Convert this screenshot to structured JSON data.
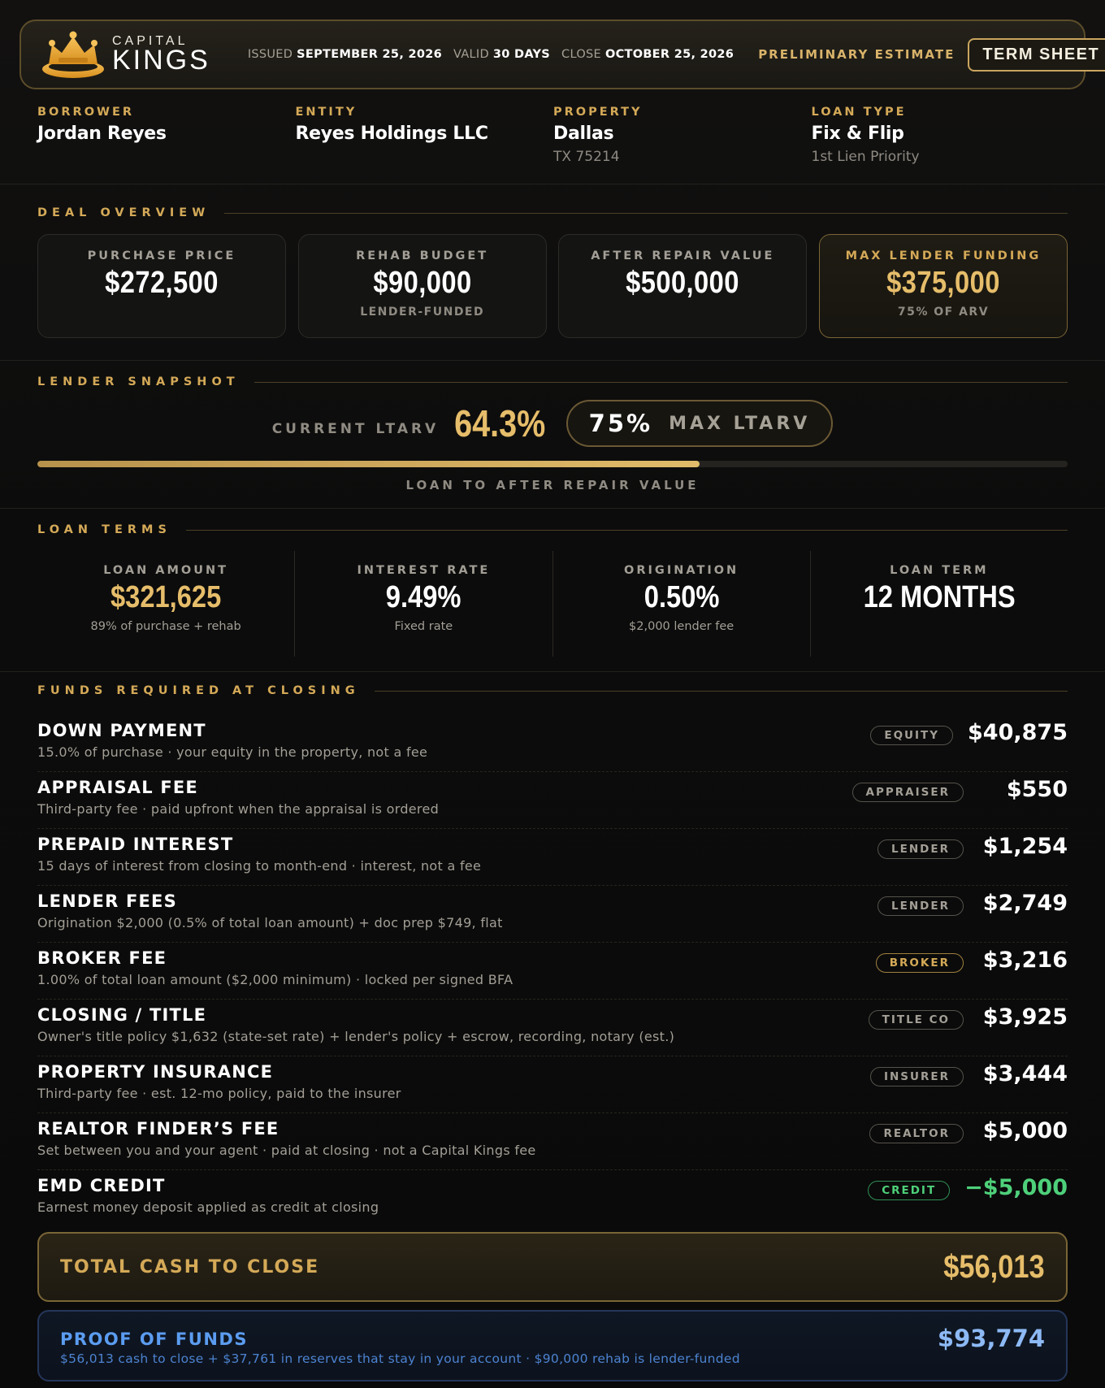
{
  "header": {
    "brand_line1": "CAPITAL",
    "brand_line2": "KINGS",
    "issued_label": "ISSUED",
    "issued_value": "SEPTEMBER 25, 2026",
    "valid_label": "VALID",
    "valid_value": "30 DAYS",
    "close_label": "CLOSE",
    "close_value": "OCTOBER 25, 2026",
    "status": "PRELIMINARY ESTIMATE",
    "button_label": "TERM SHEET",
    "colors": {
      "accent": "#d4a957",
      "border": "#5c4d2a"
    }
  },
  "info": [
    {
      "label": "BORROWER",
      "value": "Jordan Reyes",
      "sub": ""
    },
    {
      "label": "ENTITY",
      "value": "Reyes Holdings LLC",
      "sub": ""
    },
    {
      "label": "PROPERTY",
      "value": "Dallas",
      "sub": "TX 75214"
    },
    {
      "label": "LOAN TYPE",
      "value": "Fix & Flip",
      "sub": "1st Lien Priority"
    }
  ],
  "deal_overview": {
    "title": "DEAL OVERVIEW",
    "cards": [
      {
        "label": "PURCHASE PRICE",
        "value": "$272,500",
        "sub": ""
      },
      {
        "label": "REHAB BUDGET",
        "value": "$90,000",
        "sub": "LENDER-FUNDED"
      },
      {
        "label": "AFTER REPAIR VALUE",
        "value": "$500,000",
        "sub": ""
      },
      {
        "label": "MAX LENDER FUNDING",
        "value": "$375,000",
        "sub": "75% OF ARV"
      }
    ]
  },
  "snapshot": {
    "title": "LENDER SNAPSHOT",
    "current_label": "CURRENT LTARV",
    "current_value": "64.3%",
    "max_value": "75%",
    "max_label": "MAX LTARV",
    "progress_fraction": 0.643,
    "bar_label": "LOAN TO AFTER REPAIR VALUE"
  },
  "loan_terms": {
    "title": "LOAN TERMS",
    "items": [
      {
        "label": "LOAN AMOUNT",
        "value": "$321,625",
        "sub": "89% of purchase + rehab"
      },
      {
        "label": "INTEREST RATE",
        "value": "9.49%",
        "sub": "Fixed rate"
      },
      {
        "label": "ORIGINATION",
        "value": "0.50%",
        "sub": "$2,000 lender fee"
      },
      {
        "label": "LOAN TERM",
        "value": "12 MONTHS",
        "sub": ""
      }
    ]
  },
  "funds": {
    "title": "FUNDS REQUIRED AT CLOSING",
    "rows": [
      {
        "title": "DOWN PAYMENT",
        "desc": "15.0% of purchase · your equity in the property, not a fee",
        "badge": "EQUITY",
        "amount": "$40,875"
      },
      {
        "title": "APPRAISAL FEE",
        "desc": "Third-party fee · paid upfront when the appraisal is ordered",
        "badge": "APPRAISER",
        "amount": "$550"
      },
      {
        "title": "PREPAID INTEREST",
        "desc": "15 days of interest from closing to month-end · interest, not a fee",
        "badge": "LENDER",
        "amount": "$1,254"
      },
      {
        "title": "LENDER FEES",
        "desc": "Origination $2,000 (0.5% of total loan amount) + doc prep $749, flat",
        "badge": "LENDER",
        "amount": "$2,749"
      },
      {
        "title": "BROKER FEE",
        "desc": "1.00% of total loan amount ($2,000 minimum) · locked per signed BFA",
        "badge": "BROKER",
        "amount": "$3,216"
      },
      {
        "title": "CLOSING / TITLE",
        "desc": "Owner's title policy $1,632 (state-set rate) + lender's policy + escrow, recording, notary (est.)",
        "badge": "TITLE CO",
        "amount": "$3,925"
      },
      {
        "title": "PROPERTY INSURANCE",
        "desc": "Third-party fee · est. 12-mo policy, paid to the insurer",
        "badge": "INSURER",
        "amount": "$3,444"
      },
      {
        "title": "REALTOR FINDER’S FEE",
        "desc": "Set between you and your agent · paid at closing · not a Capital Kings fee",
        "badge": "REALTOR",
        "amount": "$5,000"
      },
      {
        "title": "EMD CREDIT",
        "desc": "Earnest money deposit applied as credit at closing",
        "badge": "CREDIT",
        "amount": "−$5,000"
      }
    ],
    "total_label": "TOTAL CASH TO CLOSE",
    "total_value": "$56,013",
    "proof_label": "PROOF OF FUNDS",
    "proof_desc": "$56,013 cash to close + $37,761 in reserves that stay in your account · $90,000 rehab is lender-funded",
    "proof_value": "$93,774"
  }
}
